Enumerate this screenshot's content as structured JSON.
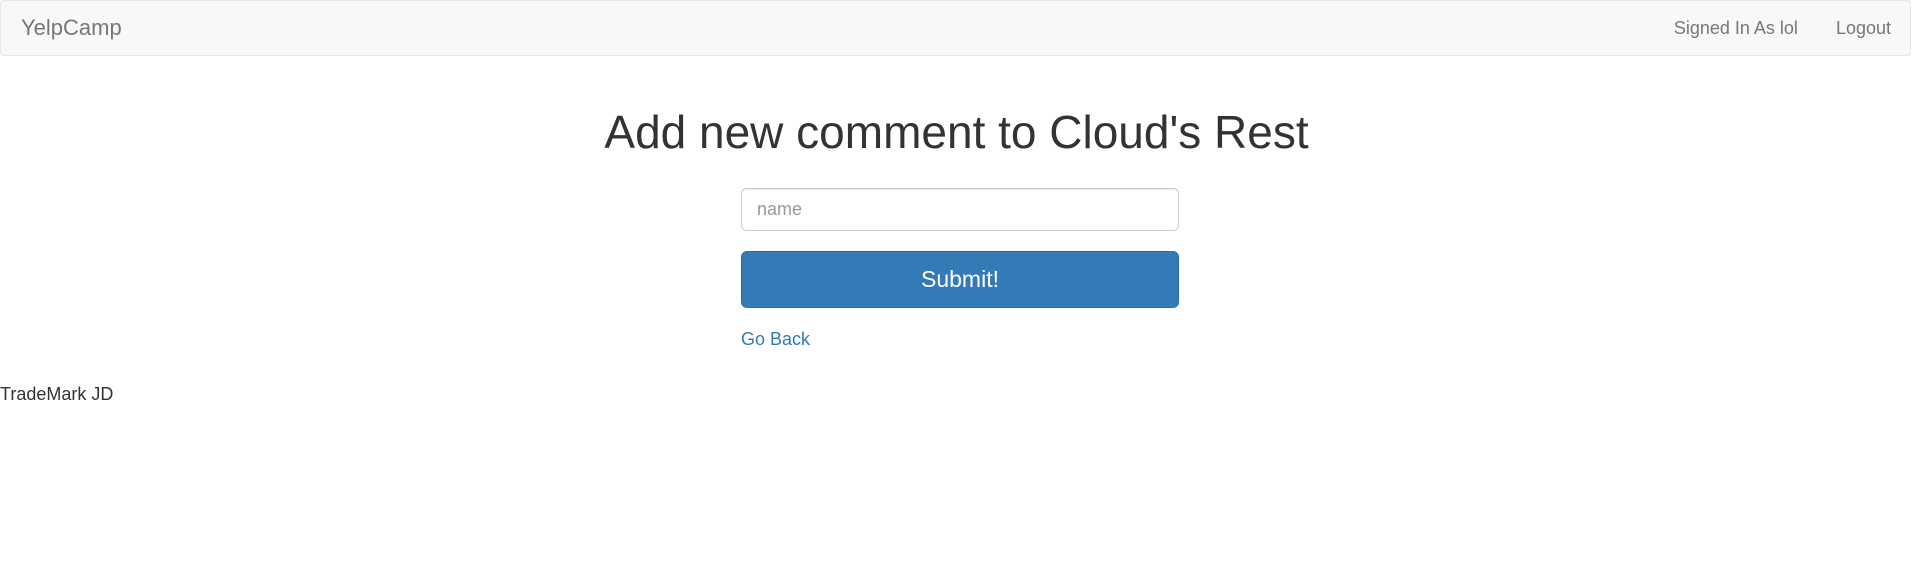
{
  "navbar": {
    "brand": "YelpCamp",
    "user_status": "Signed In As lol",
    "logout_label": "Logout"
  },
  "main": {
    "title": "Add new comment to Cloud's Rest",
    "input_placeholder": "name",
    "input_value": "",
    "submit_label": "Submit!",
    "back_label": "Go Back"
  },
  "footer": {
    "text": "TradeMark JD"
  },
  "colors": {
    "navbar_bg": "#f8f8f8",
    "primary": "#337ab7",
    "link": "#337ab7",
    "muted": "#777777"
  }
}
